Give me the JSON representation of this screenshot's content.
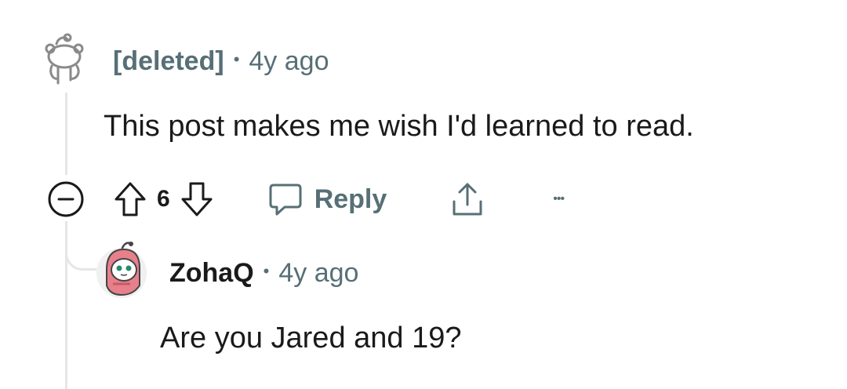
{
  "comments": [
    {
      "author": "[deleted]",
      "separator": "•",
      "age": "4y ago",
      "body": "This post makes me wish I'd learned to read.",
      "score": "6",
      "reply_label": "Reply",
      "more_label": "•••"
    },
    {
      "author": "ZohaQ",
      "separator": "•",
      "age": "4y ago",
      "body": "Are you Jared and 19?"
    }
  ],
  "colors": {
    "meta_gray": "#576f76",
    "text": "#1a1a1b",
    "thread_line": "#e6e6e6"
  },
  "icons": {
    "collapse": "collapse-icon",
    "upvote": "upvote-icon",
    "downvote": "downvote-icon",
    "reply": "speech-bubble-icon",
    "share": "share-icon",
    "more": "more-options-icon"
  }
}
